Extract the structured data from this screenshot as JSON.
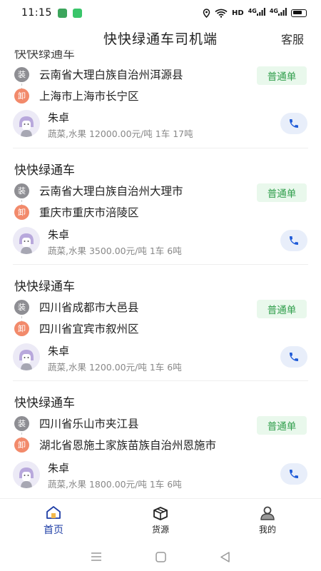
{
  "status_bar": {
    "time": "11:15",
    "network": "HD",
    "signal1": "4G",
    "signal2": "4G",
    "app_colors": [
      "#4caf50",
      "#35c26b"
    ]
  },
  "header": {
    "title": "快快绿通车司机端",
    "service": "客服"
  },
  "top_partial_company": "快快绿通车",
  "orders": [
    {
      "company": "",
      "load": "云南省大理白族自治州洱源县",
      "unload": "上海市上海市长宁区",
      "badge": "普通单",
      "driver": "朱卓",
      "cargo": "蔬菜,水果 12000.00元/吨 1车 17吨"
    },
    {
      "company": "快快绿通车",
      "load": "云南省大理白族自治州大理市",
      "unload": "重庆市重庆市涪陵区",
      "badge": "普通单",
      "driver": "朱卓",
      "cargo": "蔬菜,水果 3500.00元/吨 1车 6吨"
    },
    {
      "company": "快快绿通车",
      "load": "四川省成都市大邑县",
      "unload": "四川省宜宾市叙州区",
      "badge": "普通单",
      "driver": "朱卓",
      "cargo": "蔬菜,水果 1200.00元/吨 1车 6吨"
    },
    {
      "company": "快快绿通车",
      "load": "四川省乐山市夹江县",
      "unload": "湖北省恩施土家族苗族自治州恩施市",
      "badge": "普通单",
      "driver": "朱卓",
      "cargo": "蔬菜,水果 1800.00元/吨 1车 6吨"
    }
  ],
  "tag_labels": {
    "load": "装",
    "unload": "卸"
  },
  "tabs": [
    {
      "label": "首页",
      "icon": "home-icon",
      "active": true
    },
    {
      "label": "货源",
      "icon": "box-icon",
      "active": false
    },
    {
      "label": "我的",
      "icon": "profile-icon",
      "active": false
    }
  ],
  "colors": {
    "accent": "#1f3ea6",
    "badge_bg": "#e9f8ec",
    "badge_text": "#2e9d4a",
    "load_tag": "#8e8e93",
    "unload_tag": "#f28a6b",
    "phone": "#1f5bd8"
  }
}
